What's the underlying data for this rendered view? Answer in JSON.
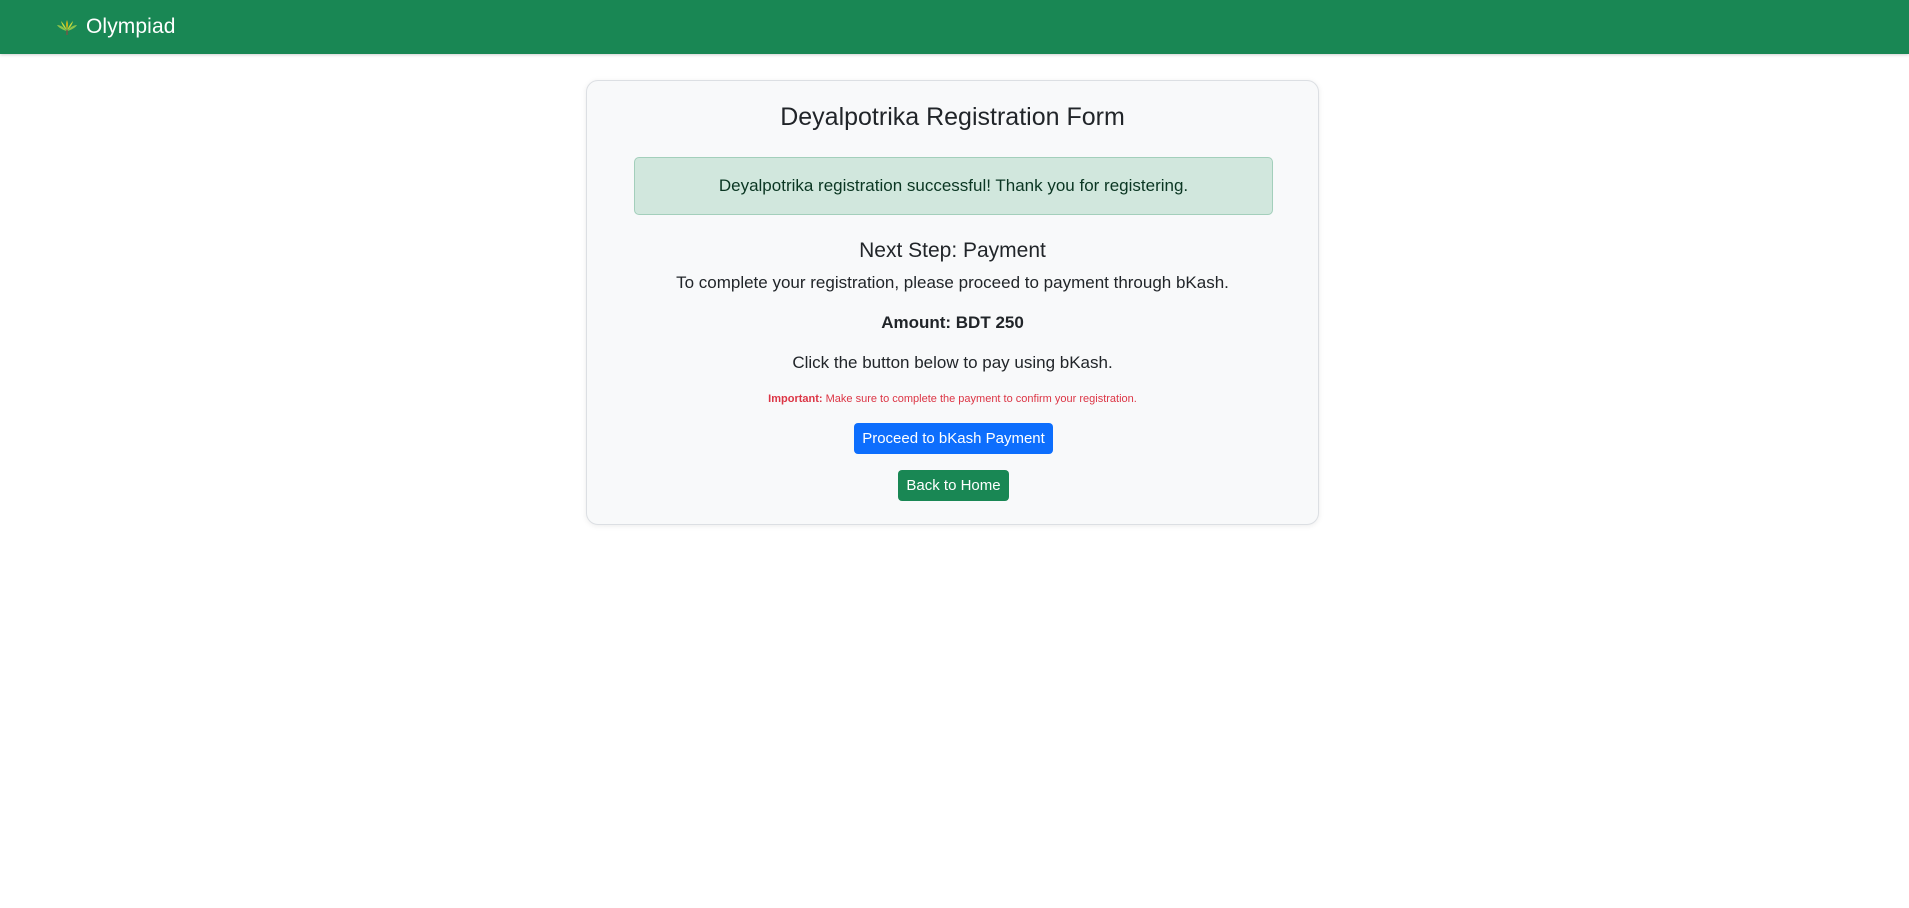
{
  "navbar": {
    "brand_icon": "olympiad-leaf-logo",
    "brand_text": "Olympiad",
    "background_color": "#198754"
  },
  "card": {
    "title": "Deyalpotrika Registration Form",
    "alert": {
      "message": "Deyalpotrika registration successful! Thank you for registering.",
      "type": "success"
    },
    "next_step": {
      "title": "Next Step: Payment",
      "instruction": "To complete your registration, please proceed to payment through bKash.",
      "amount": "Amount: BDT 250",
      "click_hint": "Click the button below to pay using bKash.",
      "important_label": "Important:",
      "important_text": "Make sure to complete the payment to confirm your registration."
    },
    "buttons": {
      "pay_label": "Proceed to bKash Payment",
      "pay_color": "#0d6efd",
      "home_label": "Back to Home",
      "home_color": "#198754"
    }
  }
}
